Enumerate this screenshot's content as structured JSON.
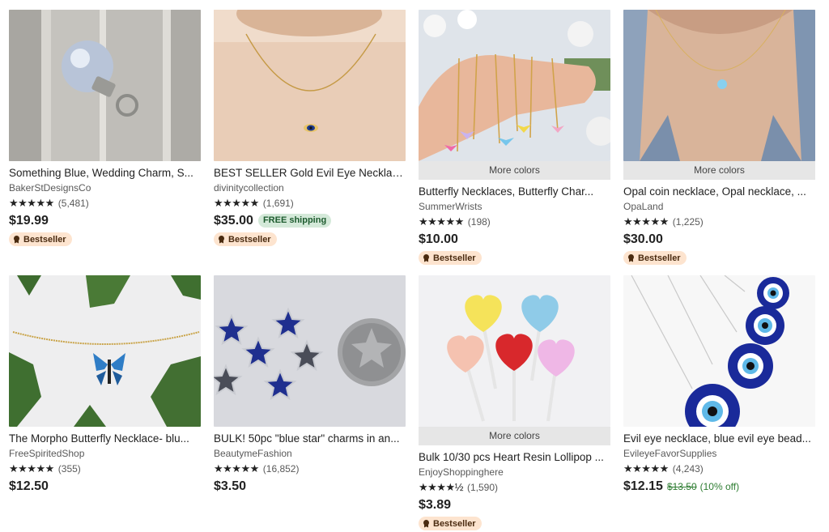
{
  "listings": [
    {
      "title": "Something Blue, Wedding Charm, S...",
      "shop": "BakerStDesignsCo",
      "stars": "★★★★★",
      "review_count": "(5,481)",
      "price": "$19.99",
      "badge": "Bestseller",
      "image": "pearl-charm-on-wood"
    },
    {
      "title": "BEST SELLER Gold Evil Eye Necklace...",
      "shop": "divinitycollection",
      "stars": "★★★★★",
      "review_count": "(1,691)",
      "price": "$35.00",
      "shipping_badge": "FREE shipping",
      "badge": "Bestseller",
      "image": "gold-evil-eye-necklace-on-neck"
    },
    {
      "more_colors": "More colors",
      "title": "Butterfly Necklaces, Butterfly Char...",
      "shop": "SummerWrists",
      "stars": "★★★★★",
      "review_count": "(198)",
      "price": "$10.00",
      "badge": "Bestseller",
      "image": "butterfly-necklaces-in-hand"
    },
    {
      "more_colors": "More colors",
      "title": "Opal coin necklace, Opal necklace, ...",
      "shop": "OpaLand",
      "stars": "★★★★★",
      "review_count": "(1,225)",
      "price": "$30.00",
      "badge": "Bestseller",
      "image": "opal-necklace-on-neck"
    },
    {
      "title": "The Morpho Butterfly Necklace- blu...",
      "shop": "FreeSpiritedShop",
      "stars": "★★★★★",
      "review_count": "(355)",
      "price": "$12.50",
      "image": "blue-butterfly-necklace-with-leaves"
    },
    {
      "title": "BULK! 50pc \"blue star\" charms in an...",
      "shop": "BeautymeFashion",
      "stars": "★★★★★",
      "review_count": "(16,852)",
      "price": "$3.50",
      "image": "blue-star-charms-and-coin"
    },
    {
      "more_colors": "More colors",
      "title": "Bulk 10/30 pcs Heart Resin Lollipop ...",
      "shop": "EnjoyShoppinghere",
      "stars": "★★★★½",
      "review_count": "(1,590)",
      "price": "$3.89",
      "badge": "Bestseller",
      "image": "heart-resin-lollipops"
    },
    {
      "title": "Evil eye necklace, blue evil eye bead...",
      "shop": "EvileyeFavorSupplies",
      "stars": "★★★★★",
      "review_count": "(4,243)",
      "price": "$12.15",
      "original_price": "$13.50",
      "discount": "(10% off)",
      "image": "blue-evil-eye-bead-necklaces"
    }
  ],
  "colors": {
    "bestseller_bg": "#fde4cf",
    "free_shipping_bg": "#d4e9d9",
    "sale_green": "#2e7d32",
    "more_colors_bg": "#e6e6e6"
  }
}
